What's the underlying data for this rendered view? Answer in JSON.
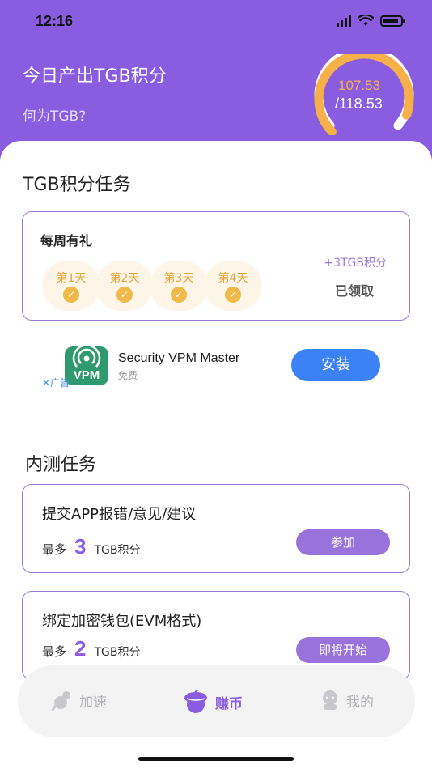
{
  "status_bar": {
    "time": "12:16"
  },
  "header": {
    "title": "今日产出TGB积分",
    "subtitle": "何为TGB?",
    "earned": "107.53",
    "total": "/118.53",
    "gauge_fraction": 0.907,
    "colors": {
      "bg": "#8a5ce0",
      "arc": "#f5b04a",
      "track": "#ffffff"
    }
  },
  "section_tasks": {
    "title": "TGB积分任务"
  },
  "weekly": {
    "title": "每周有礼",
    "days": [
      "第1天",
      "第2天",
      "第3天",
      "第4天"
    ],
    "reward": "+3TGB积分",
    "status": "已领取"
  },
  "ad": {
    "icon_text": "VPM",
    "app_name": "Security VPM Master",
    "free_label": "免费",
    "ad_mark": "✕广告",
    "install_label": "安装"
  },
  "section_beta": {
    "title": "内测任务"
  },
  "tasks": [
    {
      "title": "提交APP报错/意见/建议",
      "prefix": "最多",
      "amount": "3",
      "unit": "TGB积分",
      "button": "参加"
    },
    {
      "title": "绑定加密钱包(EVM格式)",
      "prefix": "最多",
      "amount": "2",
      "unit": "TGB积分",
      "button": "即将开始"
    }
  ],
  "tabbar": {
    "items": [
      {
        "label": "加速",
        "icon": "speed-icon",
        "active": false
      },
      {
        "label": "赚币",
        "icon": "acorn-icon",
        "active": true
      },
      {
        "label": "我的",
        "icon": "profile-icon",
        "active": false
      }
    ],
    "active_color": "#8a5ce0",
    "inactive_color": "#b4b4b8"
  }
}
